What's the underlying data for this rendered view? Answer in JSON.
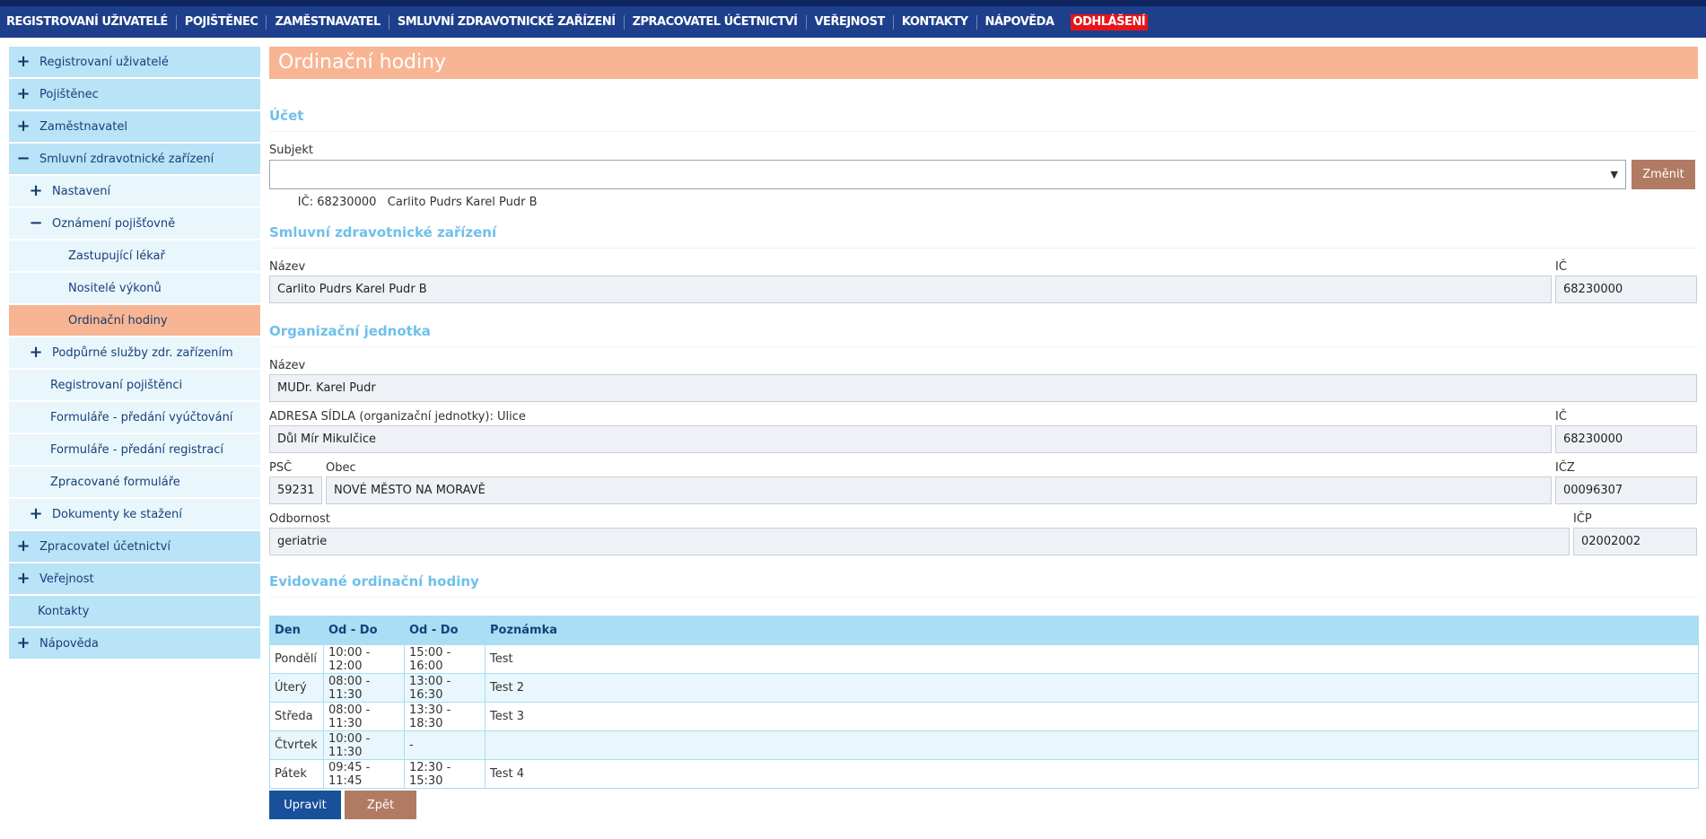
{
  "topnav": {
    "items": [
      "REGISTROVANÍ UŽIVATELÉ",
      "POJIŠTĚNEC",
      "ZAMĚSTNAVATEL",
      "SMLUVNÍ ZDRAVOTNICKÉ ZAŘÍZENÍ",
      "ZPRACOVATEL ÚČETNICTVÍ",
      "VEŘEJNOST",
      "KONTAKTY",
      "NÁPOVĚDA"
    ],
    "logout": "ODHLÁŠENÍ"
  },
  "sidebar": {
    "items": [
      {
        "label": "Registrovaní uživatelé",
        "icon": "+"
      },
      {
        "label": "Pojištěnec",
        "icon": "+"
      },
      {
        "label": "Zaměstnavatel",
        "icon": "+"
      },
      {
        "label": "Smluvní zdravotnické zařízení",
        "icon": "−"
      },
      {
        "label": "Nastavení",
        "icon": "+"
      },
      {
        "label": "Oznámení pojišťovně",
        "icon": "−"
      },
      {
        "label": "Zastupující lékař"
      },
      {
        "label": "Nositelé výkonů"
      },
      {
        "label": "Ordinační hodiny"
      },
      {
        "label": "Podpůrné služby zdr. zařízením",
        "icon": "+"
      },
      {
        "label": "Registrovaní pojištěnci"
      },
      {
        "label": "Formuláře - předání vyúčtování"
      },
      {
        "label": "Formuláře - předání registrací"
      },
      {
        "label": "Zpracované formuláře"
      },
      {
        "label": "Dokumenty ke stažení",
        "icon": "+"
      },
      {
        "label": "Zpracovatel účetnictví",
        "icon": "+"
      },
      {
        "label": "Veřejnost",
        "icon": "+"
      },
      {
        "label": "Kontakty"
      },
      {
        "label": "Nápověda",
        "icon": "+"
      }
    ]
  },
  "page": {
    "title": "Ordinační hodiny"
  },
  "ucet": {
    "section_title": "Účet",
    "subjekt_label": "Subjekt",
    "subjekt_value": "IČ: 68230000   Carlito Pudrs Karel Pudr B",
    "change_button": "Změnit"
  },
  "szz": {
    "section_title": "Smluvní zdravotnické zařízení",
    "nazev_label": "Název",
    "nazev_value": "Carlito Pudrs Karel Pudr B",
    "ic_label": "IČ",
    "ic_value": "68230000"
  },
  "oj": {
    "section_title": "Organizační jednotka",
    "nazev_label": "Název",
    "nazev_value": "MUDr. Karel Pudr",
    "adresa_label": "ADRESA SÍDLA (organizační jednotky): Ulice",
    "adresa_value": "Důl Mír Mikulčice",
    "ic_label": "IČ",
    "ic_value": "68230000",
    "psc_label": "PSČ",
    "psc_value": "59231",
    "obec_label": "Obec",
    "obec_value": "NOVÉ MĚSTO NA MORAVĚ",
    "icz_label": "IČZ",
    "icz_value": "00096307",
    "odbornost_label": "Odbornost",
    "odbornost_value": "geriatrie",
    "icp_label": "IČP",
    "icp_value": "02002002"
  },
  "hours": {
    "section_title": "Evidované ordinační hodiny",
    "headers": [
      "Den",
      "Od - Do",
      "Od - Do",
      "Poznámka"
    ],
    "rows": [
      [
        "Pondělí",
        "10:00 - 12:00",
        "15:00 - 16:00",
        "Test"
      ],
      [
        "Úterý",
        "08:00 - 11:30",
        "13:00 - 16:30",
        "Test 2"
      ],
      [
        "Středa",
        "08:00 - 11:30",
        "13:30 - 18:30",
        "Test 3"
      ],
      [
        "Čtvrtek",
        "10:00 - 11:30",
        "-",
        ""
      ],
      [
        "Pátek",
        "09:45 - 11:45",
        "12:30 - 15:30",
        "Test 4"
      ]
    ]
  },
  "actions": {
    "edit": "Upravit",
    "back": "Zpět"
  },
  "colors": {
    "nav_bg": "#1e3f8c",
    "logout_bg": "#e8141a",
    "accent_orange": "#f8b593",
    "section_blue": "#6fc0ea",
    "sidebar_l1": "#b9e3f6",
    "sidebar_l2": "#e9f6fc",
    "btn_brown": "#b17a63",
    "btn_blue": "#18509a"
  }
}
